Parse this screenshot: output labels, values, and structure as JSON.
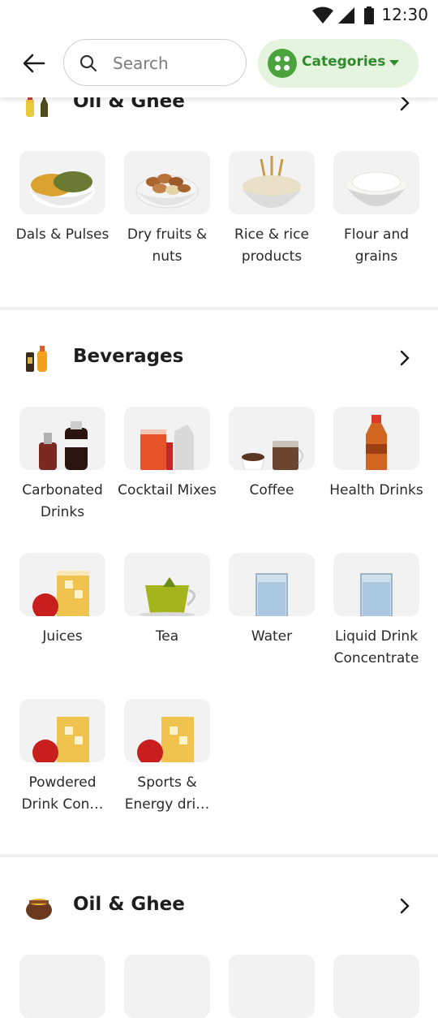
{
  "status": {
    "time": "12:30"
  },
  "search": {
    "placeholder": "Search"
  },
  "categories_button": {
    "label": "Categories"
  },
  "sections": [
    {
      "title": "Oil & Ghee",
      "items": [
        "Dals & Pulses",
        "Dry fruits & nuts",
        "Rice & rice products",
        "Flour and grains"
      ]
    },
    {
      "title": "Beverages",
      "items": [
        "Carbonated Drinks",
        "Cocktail Mixes",
        "Coffee",
        "Health Drinks",
        "Juices",
        "Tea",
        "Water",
        "Liquid Drink Concentrate",
        "Powdered Drink Con…",
        "Sports & Energy dri…"
      ]
    },
    {
      "title": "Oil & Ghee",
      "items": []
    }
  ],
  "colors": {
    "accent": "#2e8b2a",
    "accent_bg": "#e5f4df",
    "tile_bg": "#f2f2f2"
  }
}
